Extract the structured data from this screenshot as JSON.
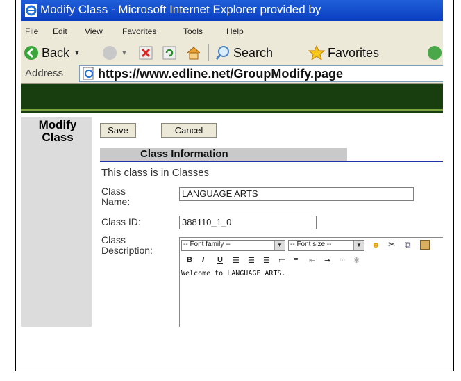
{
  "window": {
    "title": "Modify Class - Microsoft Internet Explorer provided by"
  },
  "menu": [
    "File",
    "Edit",
    "View",
    "Favorites",
    "Tools",
    "Help"
  ],
  "toolbar": {
    "back_label": "Back",
    "search_label": "Search",
    "favorites_label": "Favorites"
  },
  "address": {
    "label": "Address",
    "url": "https://www.edline.net/GroupModify.page"
  },
  "sidebar": {
    "heading": "Modify Class"
  },
  "actions": {
    "save_label": "Save",
    "cancel_label": "Cancel"
  },
  "section": {
    "title": "Class Information"
  },
  "form": {
    "location_text": "This class is in Classes",
    "class_name_label": "Class Name:",
    "class_name_value": "LANGUAGE ARTS",
    "class_id_label": "Class ID:",
    "class_id_value": "388110_1_0",
    "class_description_label": "Class Description:"
  },
  "editor": {
    "font_family_placeholder": "-- Font family --",
    "font_size_placeholder": "-- Font size --",
    "content": "Welcome to LANGUAGE ARTS."
  },
  "colors": {
    "titlebar": "#0a3ec1",
    "banner": "#183e10",
    "section_rule": "#2233aa"
  }
}
